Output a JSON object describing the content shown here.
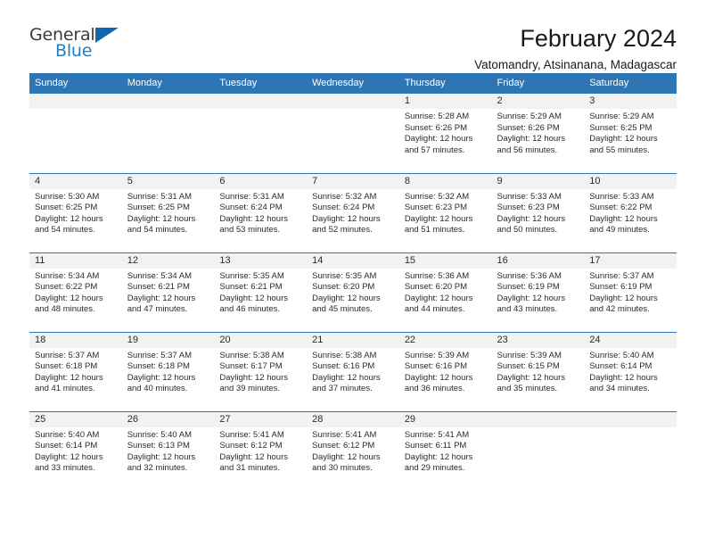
{
  "brand": {
    "name_top": "General",
    "name_bottom": "Blue",
    "accent_color": "#1f7dc4",
    "triangle_color": "#1166ad"
  },
  "header": {
    "title": "February 2024",
    "subtitle": "Vatomandry, Atsinanana, Madagascar"
  },
  "theme": {
    "header_bg": "#2e75b6",
    "daynum_bg": "#f2f2f2",
    "grid_line": "#2e75b6",
    "text": "#2b2b2b"
  },
  "weekdays": [
    "Sunday",
    "Monday",
    "Tuesday",
    "Wednesday",
    "Thursday",
    "Friday",
    "Saturday"
  ],
  "weeks": [
    [
      {
        "day": "",
        "sunrise": "",
        "sunset": "",
        "daylight1": "",
        "daylight2": ""
      },
      {
        "day": "",
        "sunrise": "",
        "sunset": "",
        "daylight1": "",
        "daylight2": ""
      },
      {
        "day": "",
        "sunrise": "",
        "sunset": "",
        "daylight1": "",
        "daylight2": ""
      },
      {
        "day": "",
        "sunrise": "",
        "sunset": "",
        "daylight1": "",
        "daylight2": ""
      },
      {
        "day": "1",
        "sunrise": "Sunrise: 5:28 AM",
        "sunset": "Sunset: 6:26 PM",
        "daylight1": "Daylight: 12 hours",
        "daylight2": "and 57 minutes."
      },
      {
        "day": "2",
        "sunrise": "Sunrise: 5:29 AM",
        "sunset": "Sunset: 6:26 PM",
        "daylight1": "Daylight: 12 hours",
        "daylight2": "and 56 minutes."
      },
      {
        "day": "3",
        "sunrise": "Sunrise: 5:29 AM",
        "sunset": "Sunset: 6:25 PM",
        "daylight1": "Daylight: 12 hours",
        "daylight2": "and 55 minutes."
      }
    ],
    [
      {
        "day": "4",
        "sunrise": "Sunrise: 5:30 AM",
        "sunset": "Sunset: 6:25 PM",
        "daylight1": "Daylight: 12 hours",
        "daylight2": "and 54 minutes."
      },
      {
        "day": "5",
        "sunrise": "Sunrise: 5:31 AM",
        "sunset": "Sunset: 6:25 PM",
        "daylight1": "Daylight: 12 hours",
        "daylight2": "and 54 minutes."
      },
      {
        "day": "6",
        "sunrise": "Sunrise: 5:31 AM",
        "sunset": "Sunset: 6:24 PM",
        "daylight1": "Daylight: 12 hours",
        "daylight2": "and 53 minutes."
      },
      {
        "day": "7",
        "sunrise": "Sunrise: 5:32 AM",
        "sunset": "Sunset: 6:24 PM",
        "daylight1": "Daylight: 12 hours",
        "daylight2": "and 52 minutes."
      },
      {
        "day": "8",
        "sunrise": "Sunrise: 5:32 AM",
        "sunset": "Sunset: 6:23 PM",
        "daylight1": "Daylight: 12 hours",
        "daylight2": "and 51 minutes."
      },
      {
        "day": "9",
        "sunrise": "Sunrise: 5:33 AM",
        "sunset": "Sunset: 6:23 PM",
        "daylight1": "Daylight: 12 hours",
        "daylight2": "and 50 minutes."
      },
      {
        "day": "10",
        "sunrise": "Sunrise: 5:33 AM",
        "sunset": "Sunset: 6:22 PM",
        "daylight1": "Daylight: 12 hours",
        "daylight2": "and 49 minutes."
      }
    ],
    [
      {
        "day": "11",
        "sunrise": "Sunrise: 5:34 AM",
        "sunset": "Sunset: 6:22 PM",
        "daylight1": "Daylight: 12 hours",
        "daylight2": "and 48 minutes."
      },
      {
        "day": "12",
        "sunrise": "Sunrise: 5:34 AM",
        "sunset": "Sunset: 6:21 PM",
        "daylight1": "Daylight: 12 hours",
        "daylight2": "and 47 minutes."
      },
      {
        "day": "13",
        "sunrise": "Sunrise: 5:35 AM",
        "sunset": "Sunset: 6:21 PM",
        "daylight1": "Daylight: 12 hours",
        "daylight2": "and 46 minutes."
      },
      {
        "day": "14",
        "sunrise": "Sunrise: 5:35 AM",
        "sunset": "Sunset: 6:20 PM",
        "daylight1": "Daylight: 12 hours",
        "daylight2": "and 45 minutes."
      },
      {
        "day": "15",
        "sunrise": "Sunrise: 5:36 AM",
        "sunset": "Sunset: 6:20 PM",
        "daylight1": "Daylight: 12 hours",
        "daylight2": "and 44 minutes."
      },
      {
        "day": "16",
        "sunrise": "Sunrise: 5:36 AM",
        "sunset": "Sunset: 6:19 PM",
        "daylight1": "Daylight: 12 hours",
        "daylight2": "and 43 minutes."
      },
      {
        "day": "17",
        "sunrise": "Sunrise: 5:37 AM",
        "sunset": "Sunset: 6:19 PM",
        "daylight1": "Daylight: 12 hours",
        "daylight2": "and 42 minutes."
      }
    ],
    [
      {
        "day": "18",
        "sunrise": "Sunrise: 5:37 AM",
        "sunset": "Sunset: 6:18 PM",
        "daylight1": "Daylight: 12 hours",
        "daylight2": "and 41 minutes."
      },
      {
        "day": "19",
        "sunrise": "Sunrise: 5:37 AM",
        "sunset": "Sunset: 6:18 PM",
        "daylight1": "Daylight: 12 hours",
        "daylight2": "and 40 minutes."
      },
      {
        "day": "20",
        "sunrise": "Sunrise: 5:38 AM",
        "sunset": "Sunset: 6:17 PM",
        "daylight1": "Daylight: 12 hours",
        "daylight2": "and 39 minutes."
      },
      {
        "day": "21",
        "sunrise": "Sunrise: 5:38 AM",
        "sunset": "Sunset: 6:16 PM",
        "daylight1": "Daylight: 12 hours",
        "daylight2": "and 37 minutes."
      },
      {
        "day": "22",
        "sunrise": "Sunrise: 5:39 AM",
        "sunset": "Sunset: 6:16 PM",
        "daylight1": "Daylight: 12 hours",
        "daylight2": "and 36 minutes."
      },
      {
        "day": "23",
        "sunrise": "Sunrise: 5:39 AM",
        "sunset": "Sunset: 6:15 PM",
        "daylight1": "Daylight: 12 hours",
        "daylight2": "and 35 minutes."
      },
      {
        "day": "24",
        "sunrise": "Sunrise: 5:40 AM",
        "sunset": "Sunset: 6:14 PM",
        "daylight1": "Daylight: 12 hours",
        "daylight2": "and 34 minutes."
      }
    ],
    [
      {
        "day": "25",
        "sunrise": "Sunrise: 5:40 AM",
        "sunset": "Sunset: 6:14 PM",
        "daylight1": "Daylight: 12 hours",
        "daylight2": "and 33 minutes."
      },
      {
        "day": "26",
        "sunrise": "Sunrise: 5:40 AM",
        "sunset": "Sunset: 6:13 PM",
        "daylight1": "Daylight: 12 hours",
        "daylight2": "and 32 minutes."
      },
      {
        "day": "27",
        "sunrise": "Sunrise: 5:41 AM",
        "sunset": "Sunset: 6:12 PM",
        "daylight1": "Daylight: 12 hours",
        "daylight2": "and 31 minutes."
      },
      {
        "day": "28",
        "sunrise": "Sunrise: 5:41 AM",
        "sunset": "Sunset: 6:12 PM",
        "daylight1": "Daylight: 12 hours",
        "daylight2": "and 30 minutes."
      },
      {
        "day": "29",
        "sunrise": "Sunrise: 5:41 AM",
        "sunset": "Sunset: 6:11 PM",
        "daylight1": "Daylight: 12 hours",
        "daylight2": "and 29 minutes."
      },
      {
        "day": "",
        "sunrise": "",
        "sunset": "",
        "daylight1": "",
        "daylight2": ""
      },
      {
        "day": "",
        "sunrise": "",
        "sunset": "",
        "daylight1": "",
        "daylight2": ""
      }
    ]
  ]
}
